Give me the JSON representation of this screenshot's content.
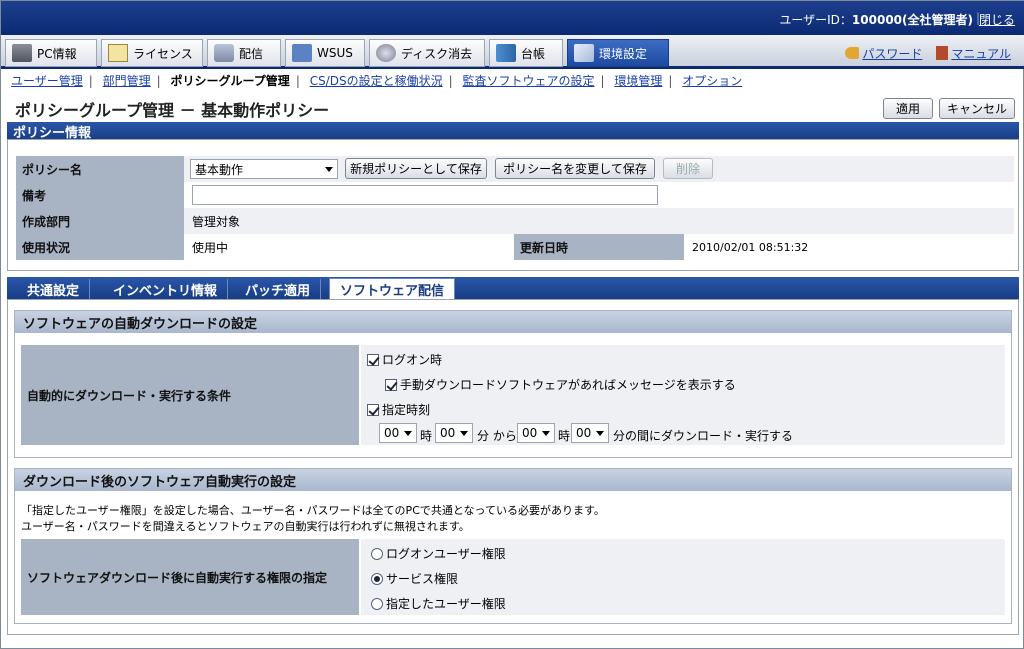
{
  "header": {
    "user_label": "ユーザーID：",
    "user_id": "100000(全社管理者)",
    "close": "閉じる"
  },
  "main_tabs": [
    {
      "label": "PC情報",
      "icon": "pc-icon"
    },
    {
      "label": "ライセンス",
      "icon": "license-icon"
    },
    {
      "label": "配信",
      "icon": "distribution-icon"
    },
    {
      "label": "WSUS",
      "icon": "wsus-icon"
    },
    {
      "label": "ディスク消去",
      "icon": "disk-erase-icon"
    },
    {
      "label": "台帳",
      "icon": "ledger-icon"
    },
    {
      "label": "環境設定",
      "icon": "settings-icon"
    }
  ],
  "right_links": {
    "password": "パスワード",
    "manual": "マニュアル"
  },
  "submenu": [
    "ユーザー管理",
    "部門管理",
    "ポリシーグループ管理",
    "CS/DSの設定と稼働状況",
    "監査ソフトウェアの設定",
    "環境管理",
    "オプション"
  ],
  "page": {
    "title": "ポリシーグループ管理 － 基本動作ポリシー",
    "apply": "適用",
    "cancel": "キャンセル"
  },
  "policy": {
    "section_title": "ポリシー情報",
    "name_label": "ポリシー名",
    "name_value": "基本動作",
    "save_new": "新規ポリシーとして保存",
    "rename_save": "ポリシー名を変更して保存",
    "delete": "削除",
    "note_label": "備考",
    "dept_label": "作成部門",
    "dept_value": "管理対象",
    "usage_label": "使用状況",
    "usage_value": "使用中",
    "updated_label": "更新日時",
    "updated_value": "2010/02/01 08:51:32"
  },
  "sub_tabs": [
    "共通設定",
    "インベントリ情報",
    "パッチ適用",
    "ソフトウェア配信"
  ],
  "auto_download": {
    "title": "ソフトウェアの自動ダウンロードの設定",
    "cond_label": "自動的にダウンロード・実行する条件",
    "logon": "ログオン時",
    "manual_msg": "手動ダウンロードソフトウェアがあればメッセージを表示する",
    "specified_time": "指定時刻",
    "h1": "00",
    "ji1": "時",
    "m1": "00",
    "fun_kara": "分 から",
    "h2": "00",
    "ji2": "時",
    "m2": "00",
    "tail": "分の間にダウンロード・実行する"
  },
  "auto_exec": {
    "title": "ダウンロード後のソフトウェア自動実行の設定",
    "note1": "「指定したユーザー権限」を設定した場合、ユーザー名・パスワードは全てのPCで共通となっている必要があります。",
    "note2": "ユーザー名・パスワードを間違えるとソフトウェアの自動実行は行われずに無視されます。",
    "auth_label": "ソフトウェアダウンロード後に自動実行する権限の指定",
    "opt1": "ログオンユーザー権限",
    "opt2": "サービス権限",
    "opt3": "指定したユーザー権限"
  }
}
